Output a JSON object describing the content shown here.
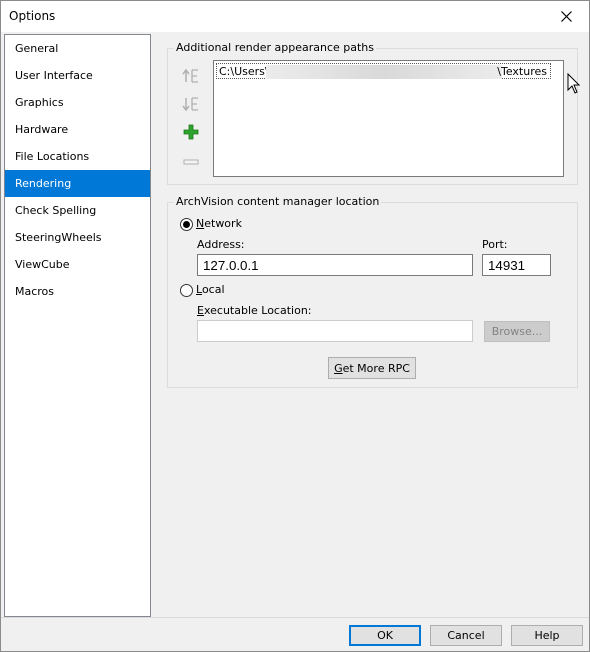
{
  "window": {
    "title": "Options"
  },
  "nav": {
    "items": [
      {
        "label": "General",
        "selected": false
      },
      {
        "label": "User Interface",
        "selected": false
      },
      {
        "label": "Graphics",
        "selected": false
      },
      {
        "label": "Hardware",
        "selected": false
      },
      {
        "label": "File Locations",
        "selected": false
      },
      {
        "label": "Rendering",
        "selected": true
      },
      {
        "label": "Check Spelling",
        "selected": false
      },
      {
        "label": "SteeringWheels",
        "selected": false
      },
      {
        "label": "ViewCube",
        "selected": false
      },
      {
        "label": "Macros",
        "selected": false
      }
    ]
  },
  "render_paths": {
    "legend": "Additional render appearance paths",
    "paths": [
      {
        "prefix": "C:\\Users\\",
        "suffix": "\\Textures"
      }
    ],
    "icons": [
      "move-up-icon",
      "move-down-icon",
      "add-icon",
      "remove-icon"
    ]
  },
  "archvision": {
    "legend": "ArchVision content manager location",
    "network": {
      "letter": "N",
      "rest": "etwork",
      "checked": true
    },
    "address": {
      "label": "Address:",
      "value": "127.0.0.1"
    },
    "port": {
      "label": "Port:",
      "value": "14931"
    },
    "local": {
      "letter": "L",
      "rest": "ocal",
      "checked": false
    },
    "executable": {
      "letter": "E",
      "rest": "xecutable Location:",
      "value": ""
    },
    "browse_label": "Browse...",
    "get_more": {
      "letter": "G",
      "rest": "et More RPC"
    }
  },
  "footer": {
    "ok": "OK",
    "cancel": "Cancel",
    "help": "Help"
  },
  "colors": {
    "accent": "#0078d7",
    "add_icon": "#2ea32e"
  }
}
